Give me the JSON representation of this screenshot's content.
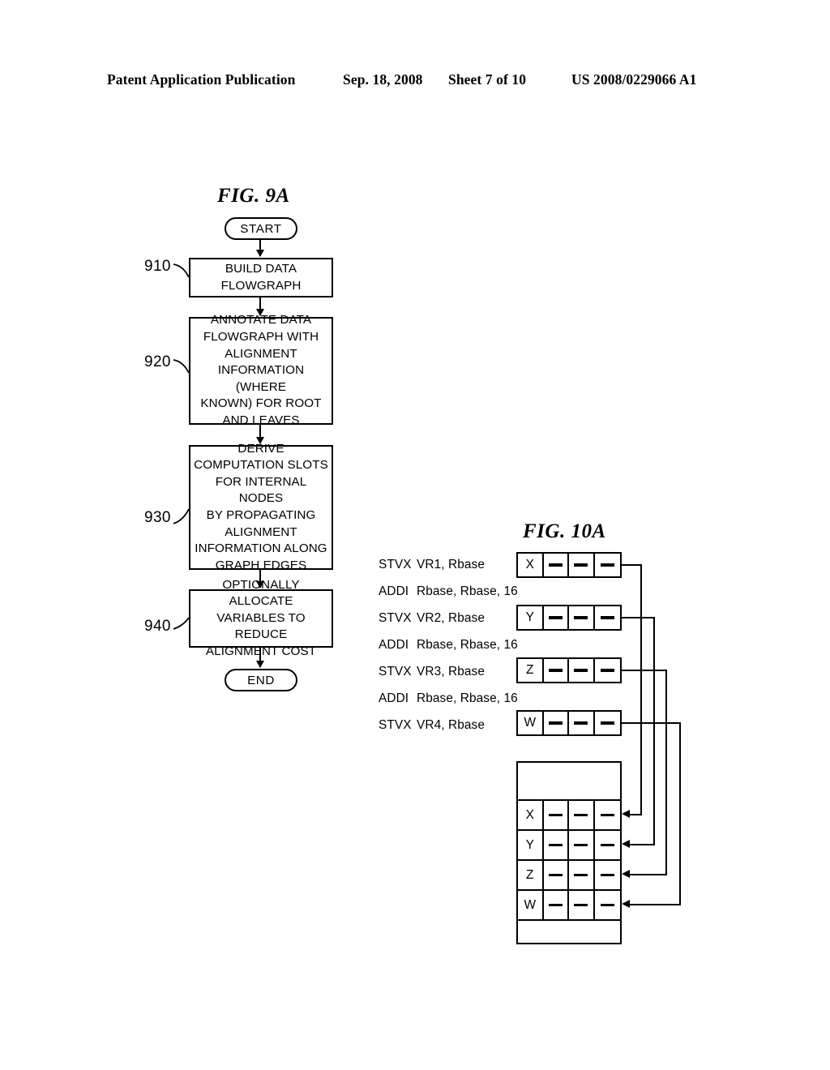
{
  "header": {
    "publication": "Patent Application Publication",
    "date": "Sep. 18, 2008",
    "sheet": "Sheet 7 of 10",
    "number": "US 2008/0229066 A1"
  },
  "fig9a": {
    "title": "FIG. 9A",
    "start_label": "START",
    "end_label": "END",
    "steps": [
      {
        "ref": "910",
        "text": "BUILD DATA\nFLOWGRAPH"
      },
      {
        "ref": "920",
        "text": "ANNOTATE DATA\nFLOWGRAPH WITH\nALIGNMENT\nINFORMATION (WHERE\nKNOWN) FOR ROOT\nAND LEAVES"
      },
      {
        "ref": "930",
        "text": "DERIVE\nCOMPUTATION SLOTS\nFOR INTERNAL NODES\nBY PROPAGATING\nALIGNMENT\nINFORMATION ALONG\nGRAPH EDGES"
      },
      {
        "ref": "940",
        "text": "OPTIONALLY ALLOCATE\nVARIABLES TO REDUCE\nALIGNMENT COST"
      }
    ]
  },
  "fig10a": {
    "title": "FIG. 10A",
    "instructions": [
      {
        "op": "STVX",
        "arg": "VR1, Rbase"
      },
      {
        "op": "ADDI",
        "arg": "Rbase, Rbase, 16"
      },
      {
        "op": "STVX",
        "arg": "VR2, Rbase"
      },
      {
        "op": "ADDI",
        "arg": "Rbase, Rbase, 16"
      },
      {
        "op": "STVX",
        "arg": "VR3, Rbase"
      },
      {
        "op": "ADDI",
        "arg": "Rbase, Rbase, 16"
      },
      {
        "op": "STVX",
        "arg": "VR4, Rbase"
      }
    ],
    "registers": [
      {
        "name": "X",
        "cells": [
          "X",
          "dash",
          "dash",
          "dash"
        ]
      },
      {
        "name": "Y",
        "cells": [
          "Y",
          "dash",
          "dash",
          "dash"
        ]
      },
      {
        "name": "Z",
        "cells": [
          "Z",
          "dash",
          "dash",
          "dash"
        ]
      },
      {
        "name": "W",
        "cells": [
          "W",
          "dash",
          "dash",
          "dash"
        ]
      }
    ],
    "memory_rows": [
      {
        "type": "empty",
        "cells": []
      },
      {
        "type": "data",
        "cells": [
          "X",
          "dash",
          "dash",
          "dash"
        ]
      },
      {
        "type": "data",
        "cells": [
          "Y",
          "dash",
          "dash",
          "dash"
        ]
      },
      {
        "type": "data",
        "cells": [
          "Z",
          "dash",
          "dash",
          "dash"
        ]
      },
      {
        "type": "data",
        "cells": [
          "W",
          "dash",
          "dash",
          "dash"
        ]
      },
      {
        "type": "empty",
        "cells": []
      }
    ]
  }
}
